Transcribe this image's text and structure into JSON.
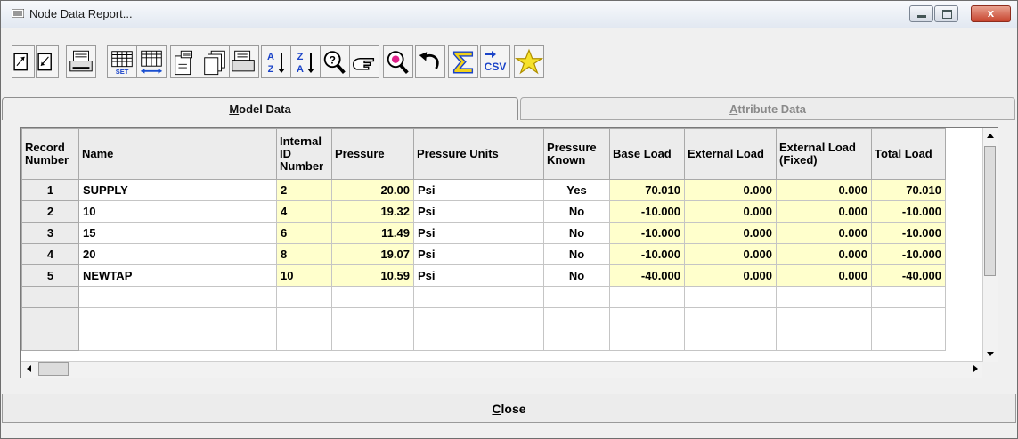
{
  "window": {
    "title": "Node Data Report...",
    "close_glyph": "x"
  },
  "toolbar": {
    "buttons": [
      {
        "name": "expand-window-icon"
      },
      {
        "name": "shrink-window-icon"
      },
      {
        "name": "print-icon"
      },
      {
        "name": "grid-set-icon",
        "text": "SET"
      },
      {
        "name": "grid-width-icon"
      },
      {
        "name": "copy-page-icon"
      },
      {
        "name": "copy-all-pages-icon"
      },
      {
        "name": "print-preview-icon"
      },
      {
        "name": "sort-ascending-icon"
      },
      {
        "name": "sort-descending-icon"
      },
      {
        "name": "find-icon"
      },
      {
        "name": "pointer-hand-icon"
      },
      {
        "name": "zoom-icon"
      },
      {
        "name": "undo-icon"
      },
      {
        "name": "sum-icon"
      },
      {
        "name": "export-csv-icon",
        "text": "CSV"
      },
      {
        "name": "favorite-star-icon"
      }
    ]
  },
  "tabs": {
    "model": {
      "label_u": "M",
      "label_rest": "odel Data"
    },
    "attribute": {
      "label_u": "A",
      "label_rest": "ttribute Data"
    }
  },
  "table": {
    "columns": [
      "Record Number",
      "Name",
      "Internal ID Number",
      "Pressure",
      "Pressure Units",
      "Pressure Known",
      "Base Load",
      "External Load",
      "External Load (Fixed)",
      "Total Load"
    ],
    "rows": [
      {
        "record": "1",
        "name": "SUPPLY",
        "id": "2",
        "pressure": "20.00",
        "units": "Psi",
        "known": "Yes",
        "base": "70.010",
        "external": "0.000",
        "fixed": "0.000",
        "total": "70.010"
      },
      {
        "record": "2",
        "name": "10",
        "id": "4",
        "pressure": "19.32",
        "units": "Psi",
        "known": "No",
        "base": "-10.000",
        "external": "0.000",
        "fixed": "0.000",
        "total": "-10.000"
      },
      {
        "record": "3",
        "name": "15",
        "id": "6",
        "pressure": "11.49",
        "units": "Psi",
        "known": "No",
        "base": "-10.000",
        "external": "0.000",
        "fixed": "0.000",
        "total": "-10.000"
      },
      {
        "record": "4",
        "name": "20",
        "id": "8",
        "pressure": "19.07",
        "units": "Psi",
        "known": "No",
        "base": "-10.000",
        "external": "0.000",
        "fixed": "0.000",
        "total": "-10.000"
      },
      {
        "record": "5",
        "name": "NEWTAP",
        "id": "10",
        "pressure": "10.59",
        "units": "Psi",
        "known": "No",
        "base": "-40.000",
        "external": "0.000",
        "fixed": "0.000",
        "total": "-40.000"
      }
    ],
    "empty_rows": 3
  },
  "close_button": {
    "label_u": "C",
    "label_rest": "lose"
  },
  "colors": {
    "highlight": "#ffffcc",
    "header": "#ececec"
  }
}
